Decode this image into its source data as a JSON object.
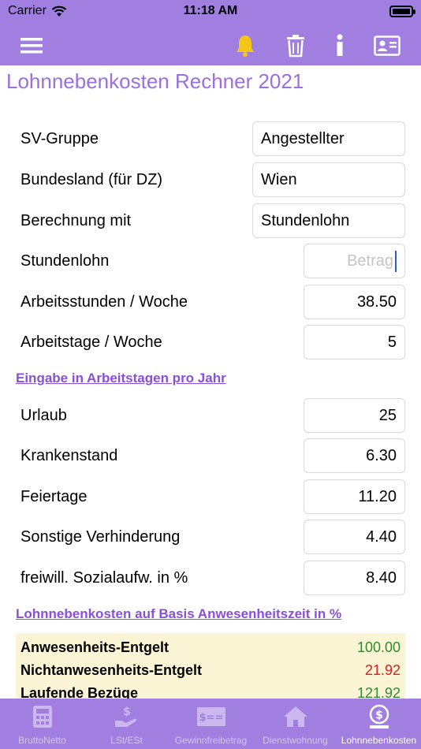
{
  "status": {
    "carrier": "Carrier",
    "time": "11:18 AM"
  },
  "nav": {
    "menu_icon": "hamburger-icon",
    "bell_icon": "bell-icon",
    "trash_icon": "trash-icon",
    "info_icon": "info-icon",
    "card_icon": "contact-card-icon",
    "bell_color": "#f5c518"
  },
  "page": {
    "title": "Lohnnebenkosten Rechner 2021"
  },
  "form": {
    "sv_gruppe": {
      "label": "SV-Gruppe",
      "value": "Angestellter"
    },
    "bundesland": {
      "label": "Bundesland (für DZ)",
      "value": "Wien"
    },
    "berechnung": {
      "label": "Berechnung mit",
      "value": "Stundenlohn"
    },
    "stundenlohn": {
      "label": "Stundenlohn",
      "value": "",
      "placeholder": "Betrag"
    },
    "arbeitsstunden": {
      "label": "Arbeitsstunden / Woche",
      "value": "38.50"
    },
    "arbeitstage": {
      "label": "Arbeitstage / Woche",
      "value": "5"
    }
  },
  "section1": {
    "link": "Eingabe in Arbeitstagen pro Jahr"
  },
  "days": {
    "urlaub": {
      "label": "Urlaub",
      "value": "25"
    },
    "krankenstand": {
      "label": "Krankenstand",
      "value": "6.30"
    },
    "feiertage": {
      "label": "Feiertage",
      "value": "11.20"
    },
    "sonstige": {
      "label": "Sonstige Verhinderung",
      "value": "4.40"
    },
    "sozial": {
      "label": "freiwill. Sozialaufw. in %",
      "value": "8.40"
    }
  },
  "section2": {
    "link": "Lohnnebenkosten auf Basis Anwesenheitszeit in %"
  },
  "results": [
    {
      "label": "Anwesenheits-Entgelt",
      "value": "100.00",
      "color": "#2e8b2e"
    },
    {
      "label": "Nichtanwesenheits-Entgelt",
      "value": "21.92",
      "color": "#d42020"
    },
    {
      "label": "Laufende Bezüge",
      "value": "121.92",
      "color": "#2e8b2e"
    }
  ],
  "tabs": [
    {
      "label": "BruttoNetto",
      "icon": "calculator-icon"
    },
    {
      "label": "LSt/ESt",
      "icon": "hand-money-icon"
    },
    {
      "label": "Gewinnfreibetrag",
      "icon": "banknote-icon"
    },
    {
      "label": "Dienstwohnung",
      "icon": "house-icon"
    },
    {
      "label": "Lohnnebenkosten",
      "icon": "money-bag-icon"
    }
  ]
}
